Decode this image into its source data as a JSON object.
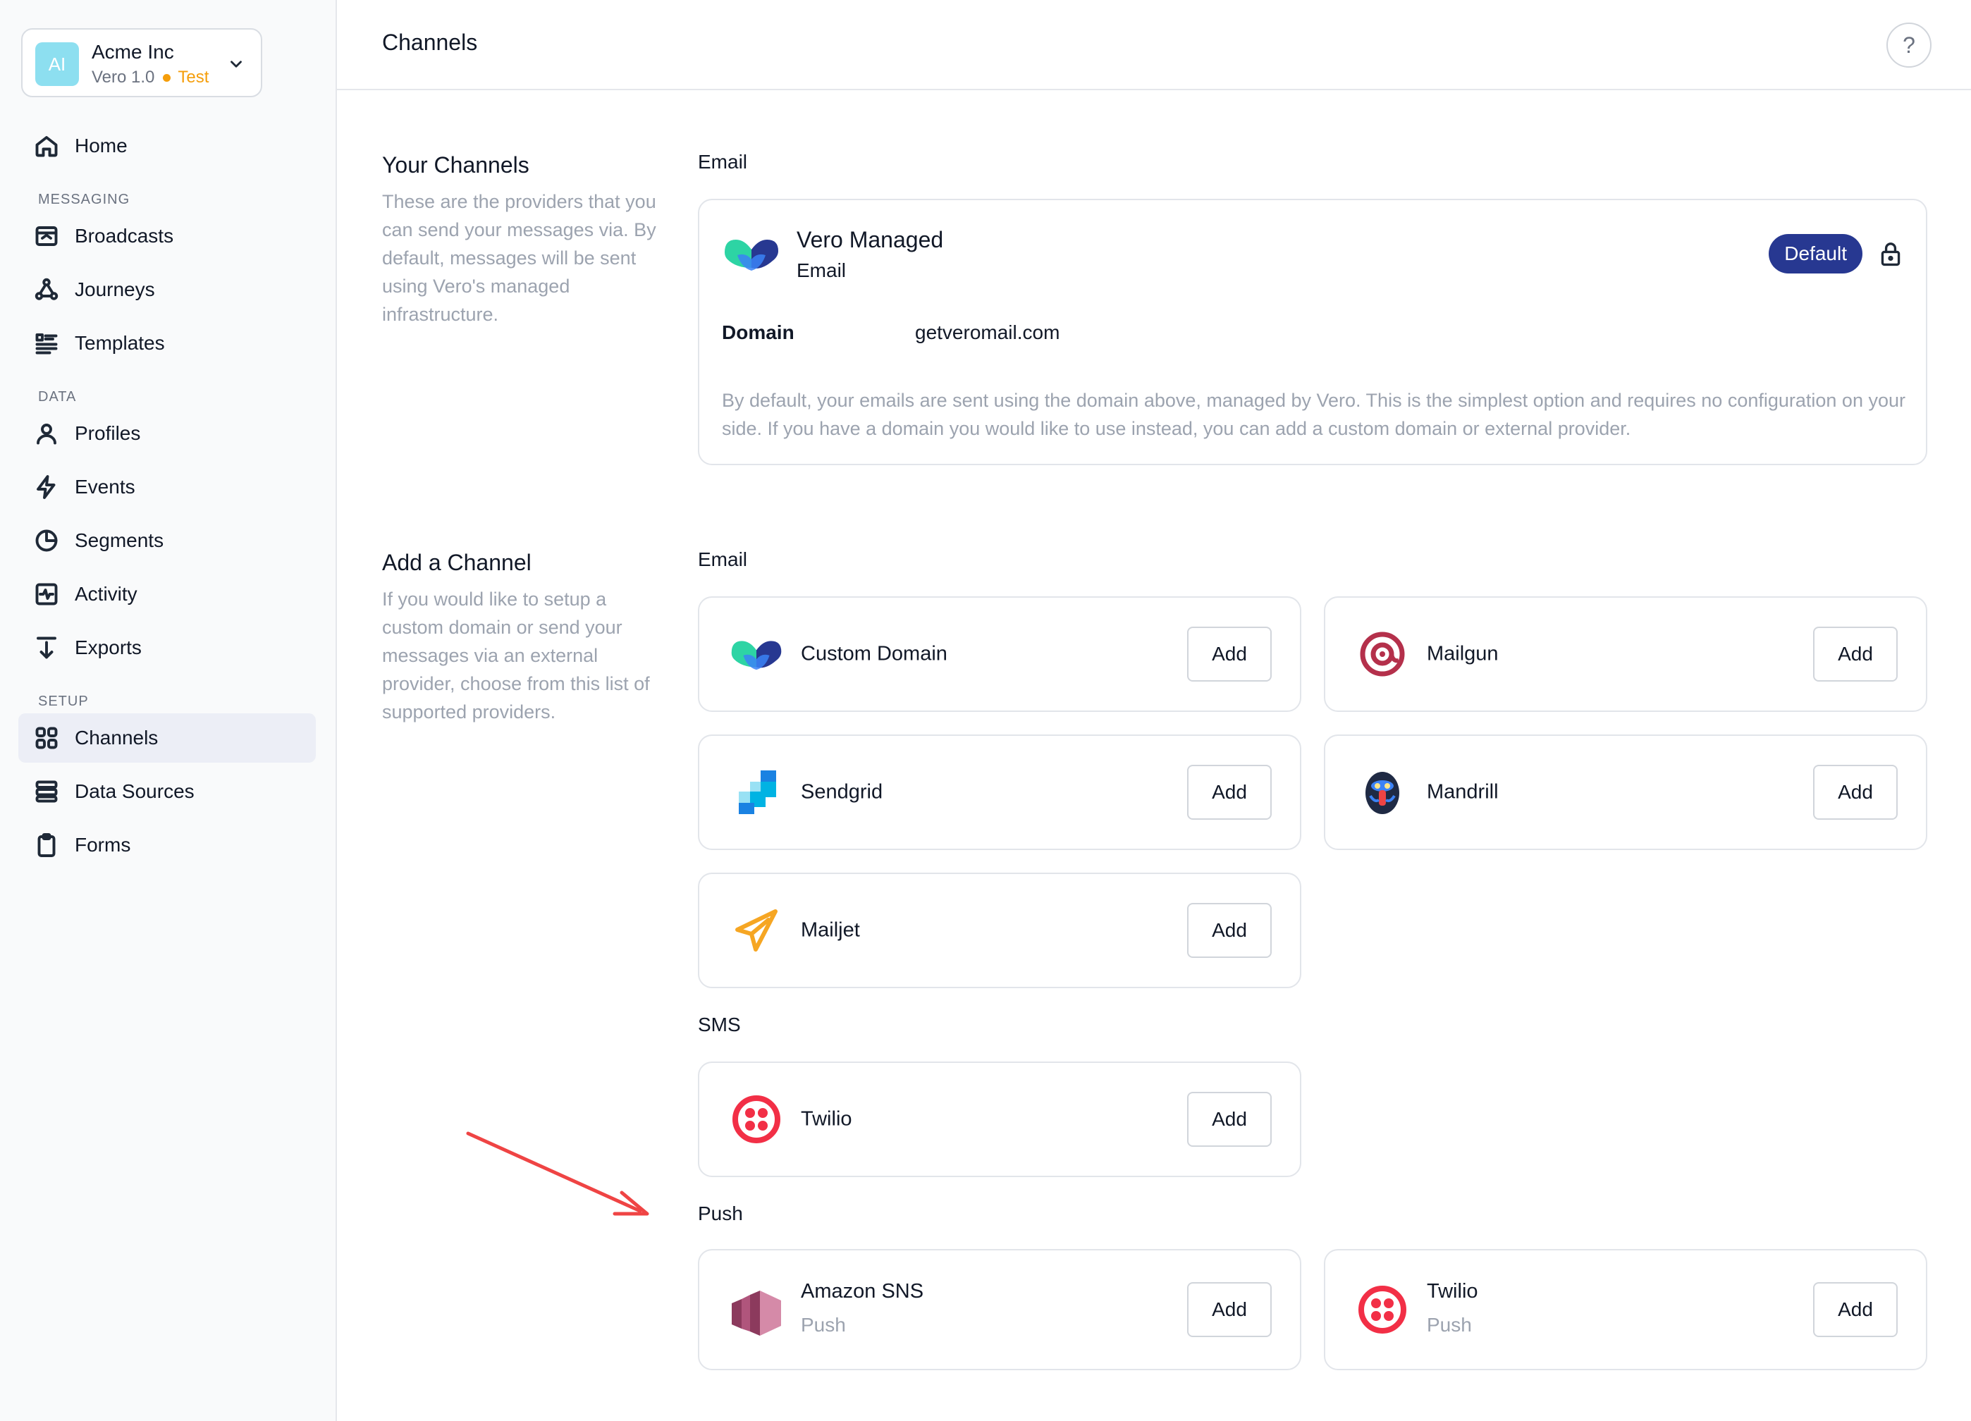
{
  "org": {
    "initials": "AI",
    "name": "Acme Inc",
    "product": "Vero 1.0",
    "env": "Test"
  },
  "nav": {
    "home": "Home",
    "section_messaging": "MESSAGING",
    "broadcasts": "Broadcasts",
    "journeys": "Journeys",
    "templates": "Templates",
    "section_data": "DATA",
    "profiles": "Profiles",
    "events": "Events",
    "segments": "Segments",
    "activity": "Activity",
    "exports": "Exports",
    "section_setup": "SETUP",
    "channels": "Channels",
    "data_sources": "Data Sources",
    "forms": "Forms",
    "active_item": "Channels"
  },
  "header": {
    "title": "Channels",
    "help": "?"
  },
  "your_channels": {
    "title": "Your Channels",
    "description": "These are the providers that you can send your messages via. By default, messages will be sent using Vero's managed infrastructure.",
    "group_label": "Email",
    "managed": {
      "name": "Vero Managed",
      "type": "Email",
      "badge": "Default",
      "domain_label": "Domain",
      "domain_value": "getveromail.com",
      "note": "By default, your emails are sent using the domain above, managed by Vero. This is the simplest option and requires no configuration on your side. If you have a domain you would like to use instead, you can add a custom domain or external provider."
    }
  },
  "add_channel": {
    "title": "Add a Channel",
    "description": "If you would like to setup a custom domain or send your messages via an external provider, choose from this list of supported providers.",
    "add_label": "Add",
    "email_label": "Email",
    "sms_label": "SMS",
    "push_label": "Push",
    "email": [
      {
        "name": "Custom Domain",
        "icon": "vero-icon"
      },
      {
        "name": "Mailgun",
        "icon": "mailgun-icon"
      },
      {
        "name": "Sendgrid",
        "icon": "sendgrid-icon"
      },
      {
        "name": "Mandrill",
        "icon": "mandrill-icon"
      },
      {
        "name": "Mailjet",
        "icon": "mailjet-icon"
      }
    ],
    "sms": [
      {
        "name": "Twilio",
        "icon": "twilio-icon"
      }
    ],
    "push": [
      {
        "name": "Amazon SNS",
        "sub": "Push",
        "icon": "amazon-sns-icon"
      },
      {
        "name": "Twilio",
        "sub": "Push",
        "icon": "twilio-icon"
      }
    ]
  },
  "colors": {
    "brand_blue": "#273891",
    "accent_teal": "#2dd4a4",
    "twilio_red": "#f22f46",
    "annotation_red": "#ef4444",
    "env_orange": "#f59e0b"
  }
}
